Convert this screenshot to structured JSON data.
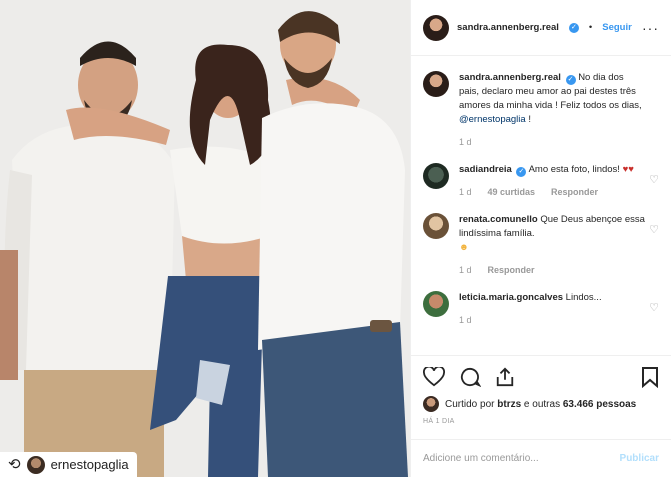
{
  "post": {
    "repost_icon": "repost-icon",
    "repost_user": "ernestopaglia"
  },
  "header": {
    "username": "sandra.annenberg.real",
    "verified_symbol": "✓",
    "dot": "•",
    "follow_label": "Seguir",
    "more_icon": "···"
  },
  "caption": {
    "username": "sandra.annenberg.real",
    "text": "No dia dos pais, declaro meu amor ao pai destes três amores da minha vida ! Feliz todos os dias, ",
    "mention": "@ernestopaglia",
    "tail": " !",
    "time": "1 d"
  },
  "comments": [
    {
      "username": "sadiandreia",
      "text": "Amo esta foto, lindos! ",
      "emoji": "♥♥",
      "time": "1 d",
      "likes": "49 curtidas",
      "reply": "Responder"
    },
    {
      "username": "renata.comunello",
      "text": "Que Deus abençoe essa lindíssima família.",
      "emoji": "☻",
      "time": "1 d",
      "reply": "Responder"
    },
    {
      "username": "leticia.maria.goncalves",
      "text": "Lindos...",
      "time": "1 d"
    }
  ],
  "actions": {
    "liked_by_prefix": "Curtido por ",
    "liked_by_user": "btrzs",
    "liked_by_suffix": " e outras ",
    "likes_count": "63.466 pessoas",
    "date": "HÁ 1 DIA"
  },
  "add_comment": {
    "placeholder": "Adicione um comentário...",
    "publish_label": "Publicar"
  }
}
